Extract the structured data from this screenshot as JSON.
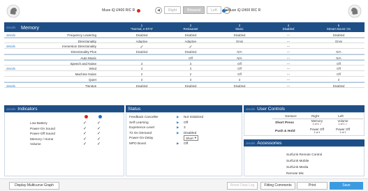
{
  "devices": {
    "left_name": "Muse iQ i2400 RIC R",
    "right_name": "Muse iQ i2400 RIC R",
    "left_color": "#e2231a",
    "right_color": "#1a73c8",
    "segments": [
      "Right",
      "Binaural",
      "Left"
    ],
    "active_segment": "Binaural"
  },
  "memory": {
    "details": "details",
    "title": "Memory",
    "columns": [
      {
        "num": "1",
        "name": "*Normal, e-STAT"
      },
      {
        "num": "2",
        "name": "Restaurant"
      },
      {
        "num": "3",
        "name": "Music"
      },
      {
        "num": "4",
        "name": "Disabled"
      },
      {
        "num": "5",
        "name": "Stream Boost: On"
      }
    ],
    "rows": [
      {
        "label": "Frequency Lowering",
        "values": [
          "Disabled",
          "Disabled",
          "Disabled",
          "---",
          "Disabled"
        ]
      },
      {
        "label": "Directionality",
        "values": [
          "Adaptive",
          "Adaptive",
          "Omni",
          "---",
          "Omni"
        ]
      },
      {
        "label": "Immersion Directionality",
        "values": [
          "✓",
          "✓",
          "",
          "---",
          ""
        ]
      },
      {
        "label": "Directionality Plus",
        "values": [
          "Disabled",
          "Disabled",
          "N/A",
          "---",
          "N/A"
        ]
      },
      {
        "label": "Auto Music",
        "values": [
          "",
          "Off",
          "N/A",
          "---",
          "N/A"
        ]
      },
      {
        "label": "Speech and Noise",
        "values": [
          "3",
          "3",
          "Off",
          "---",
          "Off"
        ]
      },
      {
        "label": "Wind",
        "values": [
          "3",
          "3",
          "Off",
          "---",
          "Off"
        ]
      },
      {
        "label": "Machine Noise",
        "values": [
          "2",
          "2",
          "Off",
          "---",
          "Off"
        ]
      },
      {
        "label": "Quiet",
        "values": [
          "3",
          "3",
          "3",
          "---",
          "3"
        ]
      },
      {
        "label": "Tinnitus",
        "values": [
          "Disabled",
          "Disabled",
          "Disabled",
          "---",
          "Disabled"
        ]
      }
    ]
  },
  "indicators": {
    "details": "details",
    "title": "Indicators",
    "items": [
      {
        "label": "Low Battery",
        "left": "✓",
        "right": "✓"
      },
      {
        "label": "Power-On Sound",
        "left": "✓",
        "right": "✓"
      },
      {
        "label": "Power-Off Sound",
        "left": "✓",
        "right": "✓"
      },
      {
        "label": "Memory / Home",
        "left": "✓",
        "right": "✓"
      },
      {
        "label": "Volume",
        "left": "✓",
        "right": "✓"
      }
    ]
  },
  "status": {
    "title": "Status",
    "items": [
      {
        "label": "Feedback Canceller",
        "value": "Not Initialized"
      },
      {
        "label": "Self Learning",
        "value": "Off"
      },
      {
        "label": "Experience Level",
        "value": "3"
      },
      {
        "label": "T2 On Demand",
        "value": "Disabled"
      },
      {
        "label": "Power-On Delay",
        "value": "Short"
      },
      {
        "label": "MPO Boost",
        "value": "Off"
      }
    ]
  },
  "user_controls": {
    "details": "details",
    "title": "User Controls",
    "headers": [
      "Gesture",
      "Right",
      "Left"
    ],
    "rows": [
      {
        "gesture": "Short Press",
        "right1": "Memory",
        "right2": "1 of 4 ✓",
        "left1": "Volume",
        "left2": "1 of 1 ✓"
      },
      {
        "gesture": "Push & Hold",
        "right1": "Power Off",
        "right2": "1 of 1",
        "left1": "Power Off",
        "left2": "1 of 1"
      }
    ]
  },
  "accessories": {
    "details": "details",
    "title": "Accessories",
    "items": [
      "SurfLink Remote Control",
      "SurfLink Mobile",
      "SurfLink Media",
      "Remote Mic"
    ]
  },
  "footer": {
    "display_graph": "Display Multicurve Graph",
    "reset": "Reset Data Log",
    "fitting_comments": "Fitting Comments",
    "print": "Print",
    "save": "Save"
  }
}
